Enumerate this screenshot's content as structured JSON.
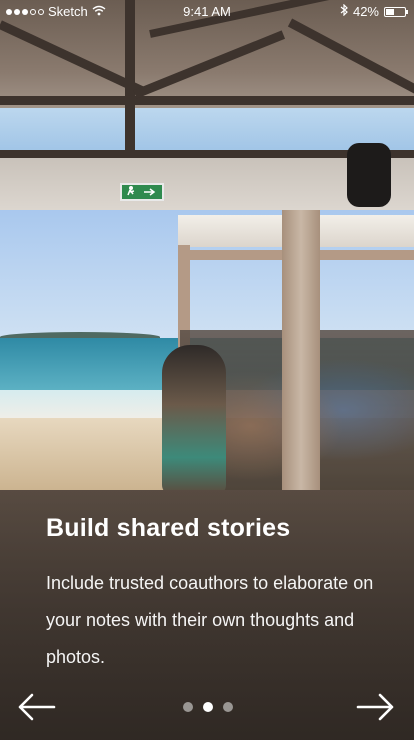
{
  "status_bar": {
    "carrier": "Sketch",
    "time": "9:41 AM",
    "battery": "42%",
    "battery_level": 0.42
  },
  "onboarding": {
    "title": "Build shared stories",
    "description": "Include trusted coauthors to elaborate on your notes with their own thoughts and photos.",
    "pager": {
      "total": 3,
      "active_index": 1
    }
  },
  "icons": {
    "signal": "signal-dots-icon",
    "wifi": "wifi-icon",
    "bluetooth": "bluetooth-icon",
    "battery": "battery-icon",
    "prev": "arrow-left-icon",
    "next": "arrow-right-icon",
    "exit_sign": "exit-sign-icon"
  },
  "colors": {
    "text": "#ffffff",
    "pager_inactive": "rgba(255,255,255,0.5)"
  }
}
